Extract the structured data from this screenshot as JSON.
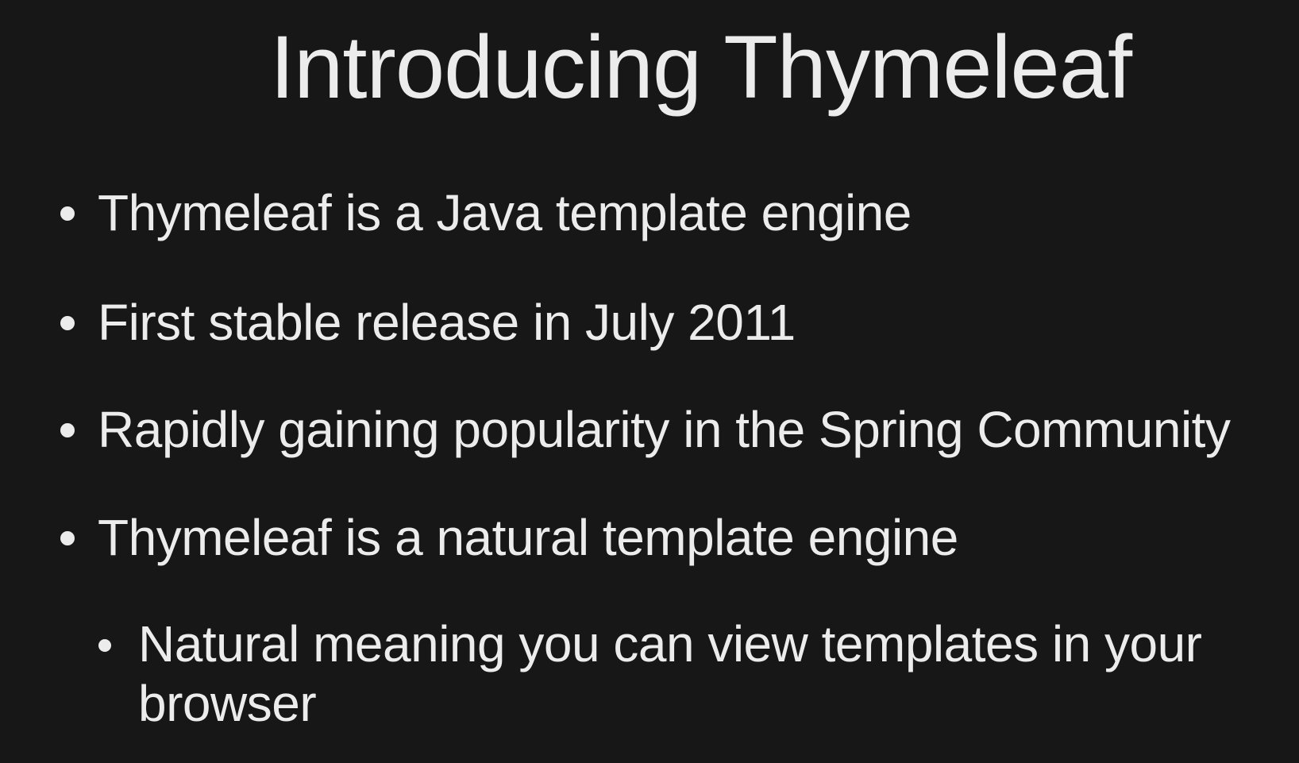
{
  "slide": {
    "title": "Introducing Thymeleaf",
    "bullets": [
      "Thymeleaf is a Java template engine",
      "First stable release in July 2011",
      "Rapidly gaining popularity in the Spring Community",
      "Thymeleaf is a natural template engine"
    ],
    "sub_bullets": [
      "Natural meaning you can view templates in your browser"
    ]
  }
}
